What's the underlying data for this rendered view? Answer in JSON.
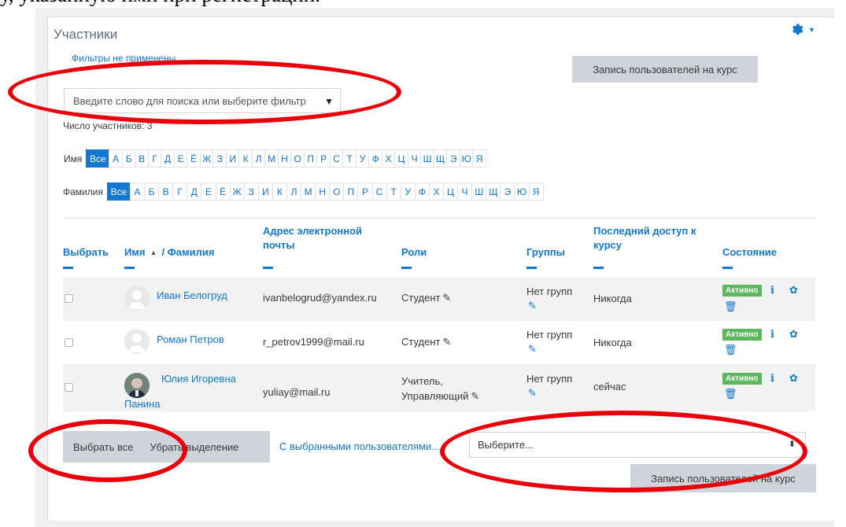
{
  "doc_fragment": "у, указанную ими при регистрации.",
  "page": {
    "title": "Участники",
    "filters_note": "Фильтры не применены",
    "enrol_button": "Запись пользователей на курс",
    "search_placeholder": "Введите слово для поиска или выберите фильтр",
    "participants_count": "Число участников: 3"
  },
  "first_name_filter": {
    "label": "Имя",
    "all": "Все",
    "letters": [
      "А",
      "Б",
      "В",
      "Г",
      "Д",
      "Е",
      "Ё",
      "Ж",
      "З",
      "И",
      "К",
      "Л",
      "М",
      "Н",
      "О",
      "П",
      "Р",
      "С",
      "Т",
      "У",
      "Ф",
      "Х",
      "Ц",
      "Ч",
      "Ш",
      "Щ",
      "Э",
      "Ю",
      "Я"
    ]
  },
  "last_name_filter": {
    "label": "Фамилия",
    "all": "Все",
    "letters": [
      "А",
      "Б",
      "В",
      "Г",
      "Д",
      "Е",
      "Ё",
      "Ж",
      "З",
      "И",
      "К",
      "Л",
      "М",
      "Н",
      "О",
      "П",
      "Р",
      "С",
      "Т",
      "У",
      "Ф",
      "Х",
      "Ц",
      "Ч",
      "Ш",
      "Щ",
      "Э",
      "Ю",
      "Я"
    ]
  },
  "table": {
    "headers": {
      "select": "Выбрать",
      "first_name": "Имя",
      "sort_arrow": "▲",
      "last_name": "/ Фамилия",
      "email_line1": "Адрес электронной",
      "email_line2": "почты",
      "roles": "Роли",
      "groups": "Группы",
      "last_access_line1": "Последний доступ к",
      "last_access_line2": "курсу",
      "status": "Состояние"
    },
    "rows": [
      {
        "name": "Иван Белогруд",
        "name2": "",
        "email": "ivanbelogrud@yandex.ru",
        "role": "Студент",
        "role2": "",
        "groups": "Нет групп",
        "last_access": "Никогда",
        "status": "Активно",
        "avatar": "default"
      },
      {
        "name": "Роман Петров",
        "name2": "",
        "email": "r_petrov1999@mail.ru",
        "role": "Студент",
        "role2": "",
        "groups": "Нет групп",
        "last_access": "Никогда",
        "status": "Активно",
        "avatar": "default"
      },
      {
        "name": "Юлия Игоревна",
        "name2": "Панина",
        "email": "yuliay@mail.ru",
        "role": "Учитель,",
        "role2": "Управляющий",
        "groups": "Нет групп",
        "last_access": "сейчас",
        "status": "Активно",
        "avatar": "photo"
      }
    ]
  },
  "bulk": {
    "select_all": "Выбрать все",
    "deselect": "Убрать выделение",
    "with_selected": "С выбранными пользователями...",
    "select_placeholder": "Выберите...",
    "select_arrow": "⬍"
  },
  "colors": {
    "accent": "#1177d1",
    "badge_green": "#5cb85c",
    "annotation_red": "#e8000b",
    "button_gray": "#ced4da",
    "row_shade": "#f2f2f2"
  }
}
